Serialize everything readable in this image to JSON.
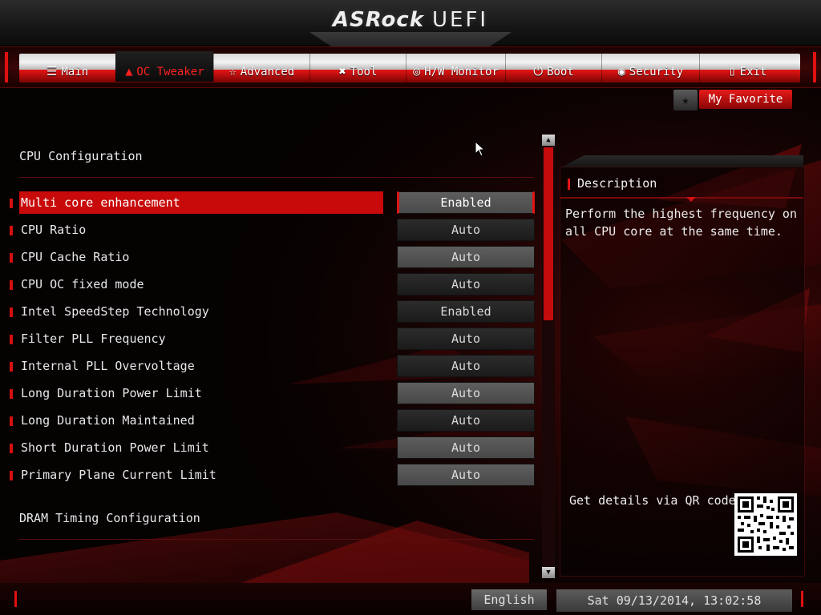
{
  "header": {
    "logo": "ASRock",
    "product": "UEFI"
  },
  "nav": {
    "tabs": [
      {
        "label": "Main",
        "icon": "list-icon",
        "glyph": "☰",
        "active": false
      },
      {
        "label": "OC Tweaker",
        "icon": "flame-icon",
        "glyph": "▲",
        "active": true
      },
      {
        "label": "Advanced",
        "icon": "star-icon",
        "glyph": "☆",
        "active": false
      },
      {
        "label": "Tool",
        "icon": "tools-icon",
        "glyph": "✖",
        "active": false
      },
      {
        "label": "H/W Monitor",
        "icon": "monitor-gauge-icon",
        "glyph": "◎",
        "active": false
      },
      {
        "label": "Boot",
        "icon": "power-icon",
        "glyph": "⏻",
        "active": false
      },
      {
        "label": "Security",
        "icon": "shield-icon",
        "glyph": "◉",
        "active": false
      },
      {
        "label": "Exit",
        "icon": "exit-door-icon",
        "glyph": "▯",
        "active": false
      }
    ]
  },
  "favorite": {
    "label": "My Favorite",
    "icon": "star-icon",
    "glyph": "★"
  },
  "main": {
    "section_title": "CPU Configuration",
    "items": [
      {
        "label": "Multi core enhancement",
        "value": "Enabled",
        "selected": true,
        "dim": false
      },
      {
        "label": "CPU Ratio",
        "value": "Auto",
        "selected": false,
        "dim": false
      },
      {
        "label": "CPU Cache Ratio",
        "value": "Auto",
        "selected": false,
        "dim": true
      },
      {
        "label": "CPU OC fixed mode",
        "value": "Auto",
        "selected": false,
        "dim": false
      },
      {
        "label": "Intel SpeedStep Technology",
        "value": "Enabled",
        "selected": false,
        "dim": false
      },
      {
        "label": "Filter PLL Frequency",
        "value": "Auto",
        "selected": false,
        "dim": false
      },
      {
        "label": "Internal PLL Overvoltage",
        "value": "Auto",
        "selected": false,
        "dim": false
      },
      {
        "label": "Long Duration Power Limit",
        "value": "Auto",
        "selected": false,
        "dim": true
      },
      {
        "label": "Long Duration Maintained",
        "value": "Auto",
        "selected": false,
        "dim": false
      },
      {
        "label": "Short Duration Power Limit",
        "value": "Auto",
        "selected": false,
        "dim": true
      },
      {
        "label": "Primary Plane Current Limit",
        "value": "Auto",
        "selected": false,
        "dim": true
      }
    ],
    "next_section_title": "DRAM Timing Configuration"
  },
  "description": {
    "title": "Description",
    "text": "Perform the highest frequency on all CPU core at the same time.",
    "qr_label": "Get details via QR code"
  },
  "footer": {
    "language": "English",
    "datetime": "Sat 09/13/2014, 13:02:58"
  },
  "colors": {
    "accent": "#c80a0a",
    "accent_bright": "#e01414",
    "background": "#050202",
    "text": "#e6e6e6"
  }
}
